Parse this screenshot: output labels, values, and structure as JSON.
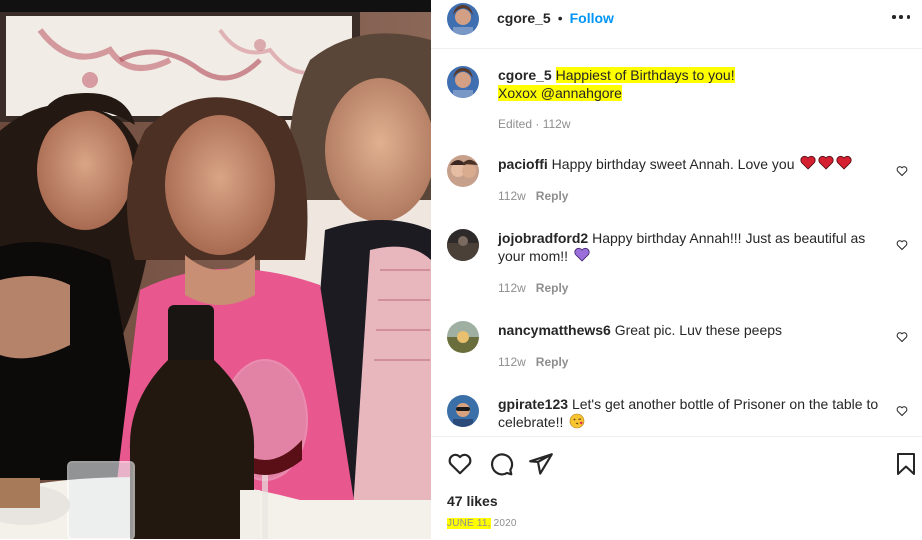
{
  "post": {
    "username": "cgore_5",
    "separator": "•",
    "follow_label": "Follow",
    "caption_line1": "Happiest of Birthdays to you!",
    "caption_line2": "Xoxox @annahgore",
    "caption_meta": "Edited · 112w",
    "likes": "47 likes",
    "date_highlight": "JUNE 11,",
    "date_year": "2020"
  },
  "comments": [
    {
      "username": "pacioffi",
      "text": "Happy birthday sweet Annah. Love you",
      "time": "112w",
      "reply": "Reply",
      "emoji": "red-heart x3"
    },
    {
      "username": "jojobradford2",
      "text": "Happy birthday Annah!!! Just as beautiful as your mom!!",
      "time": "112w",
      "reply": "Reply",
      "emoji": "purple-heart"
    },
    {
      "username": "nancymatthews6",
      "text": "Great pic. Luv these peeps",
      "time": "112w",
      "reply": "Reply"
    },
    {
      "username": "gpirate123",
      "text": "Let's get another bottle of Prisoner on the table to celebrate!!",
      "emoji": "kissing-face"
    }
  ],
  "colors": {
    "accent": "#0095f6",
    "highlight": "#ffff00",
    "text": "#262626",
    "muted": "#8e8e8e",
    "heart": "#e0245e"
  }
}
